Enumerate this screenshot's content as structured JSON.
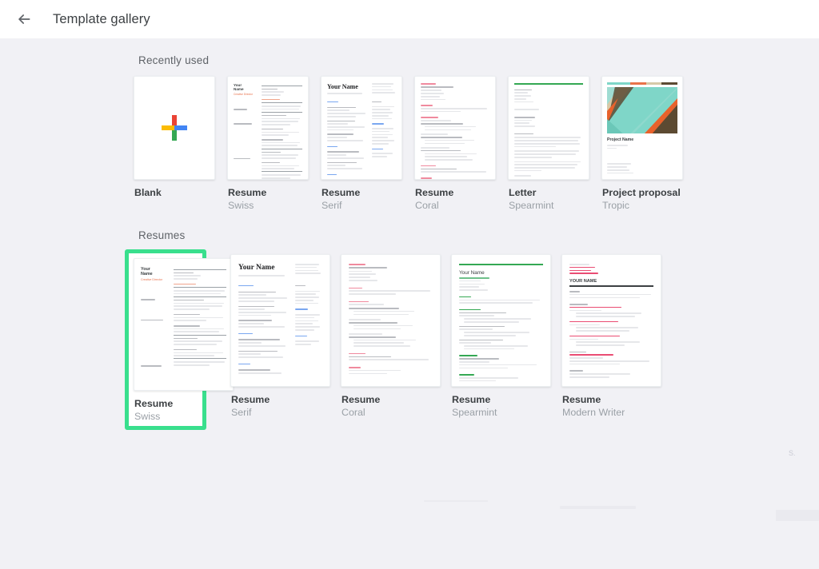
{
  "header": {
    "back_icon": "arrow-left-icon",
    "title": "Template gallery"
  },
  "sections": [
    {
      "id": "recently-used",
      "title": "Recently used",
      "cards": [
        {
          "name": "Blank",
          "sub": "",
          "style": "blank",
          "selected": false
        },
        {
          "name": "Resume",
          "sub": "Swiss",
          "style": "swiss",
          "selected": false
        },
        {
          "name": "Resume",
          "sub": "Serif",
          "style": "serif",
          "selected": false
        },
        {
          "name": "Resume",
          "sub": "Coral",
          "style": "coral",
          "selected": false
        },
        {
          "name": "Letter",
          "sub": "Spearmint",
          "style": "letter",
          "selected": false
        },
        {
          "name": "Project proposal",
          "sub": "Tropic",
          "style": "tropic",
          "selected": false
        }
      ]
    },
    {
      "id": "resumes",
      "title": "Resumes",
      "cards": [
        {
          "name": "Resume",
          "sub": "Swiss",
          "style": "swiss",
          "selected": true
        },
        {
          "name": "Resume",
          "sub": "Serif",
          "style": "serif",
          "selected": false
        },
        {
          "name": "Resume",
          "sub": "Coral",
          "style": "coral",
          "selected": false
        },
        {
          "name": "Resume",
          "sub": "Spearmint",
          "style": "spearmint",
          "selected": false
        },
        {
          "name": "Resume",
          "sub": "Modern Writer",
          "style": "modern",
          "selected": false
        }
      ]
    }
  ],
  "thumb_text": {
    "your_name_line1": "Your",
    "your_name_line2": "Name",
    "your_name": "Your Name",
    "creative_director": "Creative Director",
    "project_name": "Project Name"
  },
  "colors": {
    "selection_green": "#39df8d",
    "page_background": "#f1f1f5",
    "header_background": "#ffffff",
    "title_text": "#3c4043",
    "subtitle_text": "#9aa0a6",
    "accent_coral": "#e8704a",
    "accent_spearmint": "#34a853",
    "accent_blue": "#4285f4",
    "accent_pink": "#ea4c73",
    "google_blue": "#4285f4",
    "google_red": "#ea4335",
    "google_yellow": "#fbbc04",
    "google_green": "#34a853",
    "tropic_mint": "#7fd6c8",
    "tropic_orange": "#e8622c",
    "tropic_tan": "#d6c9a8",
    "tropic_brown": "#5c4a32"
  },
  "corner_text": "S."
}
